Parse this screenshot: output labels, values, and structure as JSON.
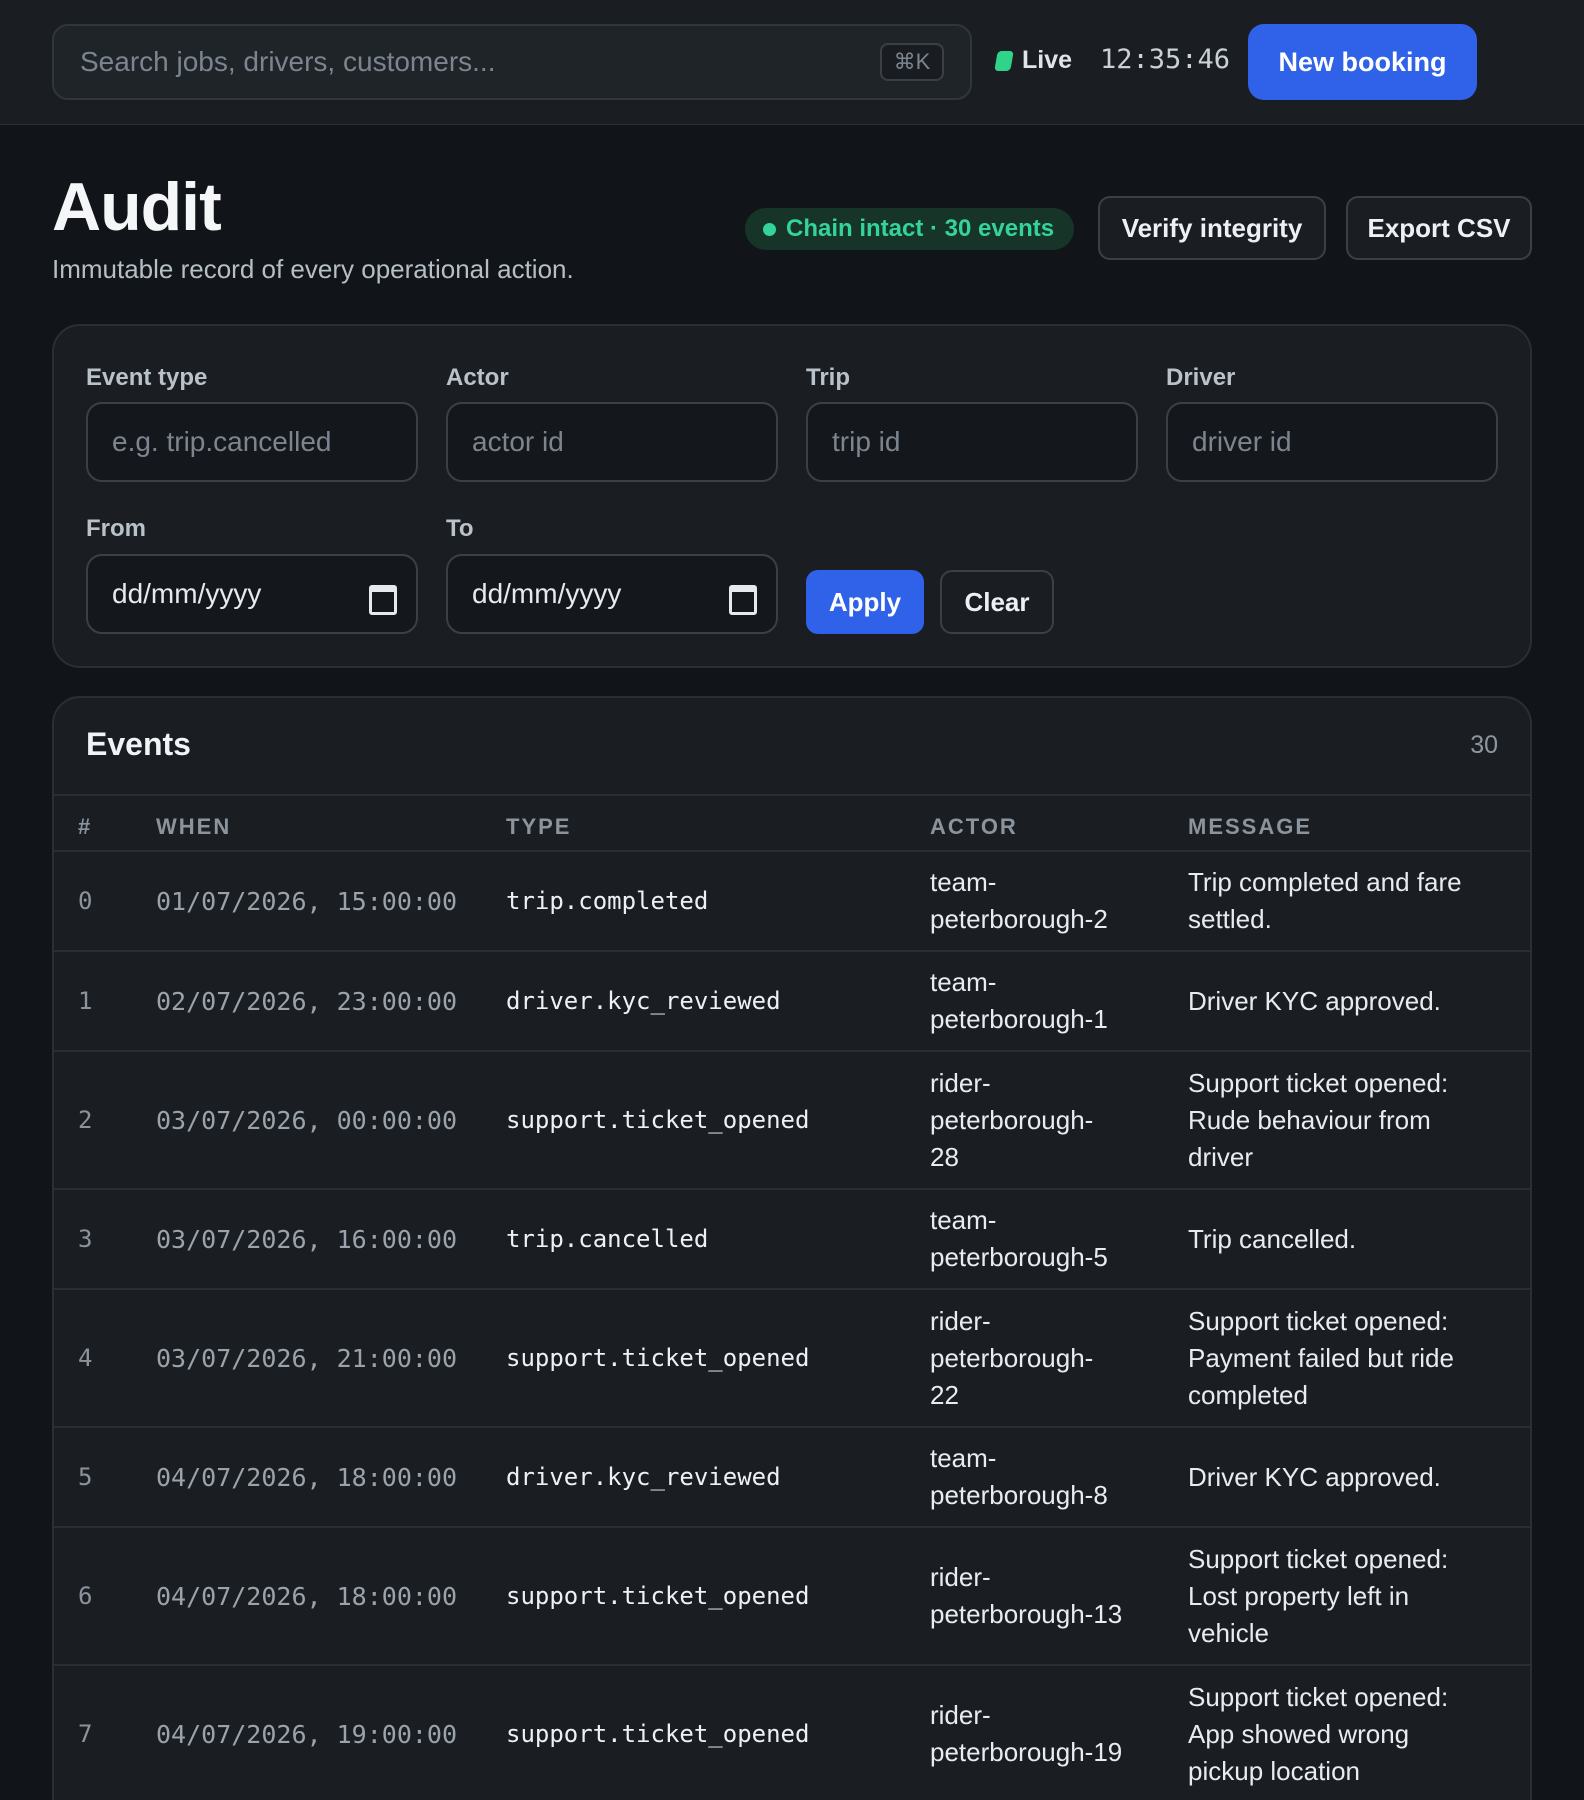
{
  "topbar": {
    "search_placeholder": "Search jobs, drivers, customers...",
    "search_shortcut": "⌘K",
    "live_label": "Live",
    "clock": "12:35:46",
    "new_booking": "New booking"
  },
  "header": {
    "title": "Audit",
    "subtitle": "Immutable record of every operational action.",
    "chain_status": "Chain intact · 30 events",
    "verify_button": "Verify integrity",
    "export_button": "Export CSV"
  },
  "filters": {
    "event_type_label": "Event type",
    "event_type_placeholder": "e.g. trip.cancelled",
    "actor_label": "Actor",
    "actor_placeholder": "actor id",
    "trip_label": "Trip",
    "trip_placeholder": "trip id",
    "driver_label": "Driver",
    "driver_placeholder": "driver id",
    "from_label": "From",
    "from_value": "dd/mm/yyyy",
    "to_label": "To",
    "to_value": "dd/mm/yyyy",
    "apply_button": "Apply",
    "clear_button": "Clear"
  },
  "events": {
    "title": "Events",
    "count": "30",
    "columns": [
      "#",
      "WHEN",
      "TYPE",
      "ACTOR",
      "MESSAGE"
    ],
    "rows": [
      {
        "num": "0",
        "when": "01/07/2026, 15:00:00",
        "type": "trip.completed",
        "actor": "team-\npeterborough-2",
        "message": "Trip completed and fare\nsettled."
      },
      {
        "num": "1",
        "when": "02/07/2026, 23:00:00",
        "type": "driver.kyc_reviewed",
        "actor": "team-\npeterborough-1",
        "message": "Driver KYC approved."
      },
      {
        "num": "2",
        "when": "03/07/2026, 00:00:00",
        "type": "support.ticket_opened",
        "actor": "rider-\npeterborough-\n28",
        "message": "Support ticket opened:\nRude behaviour from\ndriver"
      },
      {
        "num": "3",
        "when": "03/07/2026, 16:00:00",
        "type": "trip.cancelled",
        "actor": "team-\npeterborough-5",
        "message": "Trip cancelled."
      },
      {
        "num": "4",
        "when": "03/07/2026, 21:00:00",
        "type": "support.ticket_opened",
        "actor": "rider-\npeterborough-\n22",
        "message": "Support ticket opened:\nPayment failed but ride\ncompleted"
      },
      {
        "num": "5",
        "when": "04/07/2026, 18:00:00",
        "type": "driver.kyc_reviewed",
        "actor": "team-\npeterborough-8",
        "message": "Driver KYC approved."
      },
      {
        "num": "6",
        "when": "04/07/2026, 18:00:00",
        "type": "support.ticket_opened",
        "actor": "rider-\npeterborough-13",
        "message": "Support ticket opened:\nLost property left in\nvehicle"
      },
      {
        "num": "7",
        "when": "04/07/2026, 19:00:00",
        "type": "support.ticket_opened",
        "actor": "rider-\npeterborough-19",
        "message": "Support ticket opened:\nApp showed wrong\npickup location"
      }
    ]
  }
}
